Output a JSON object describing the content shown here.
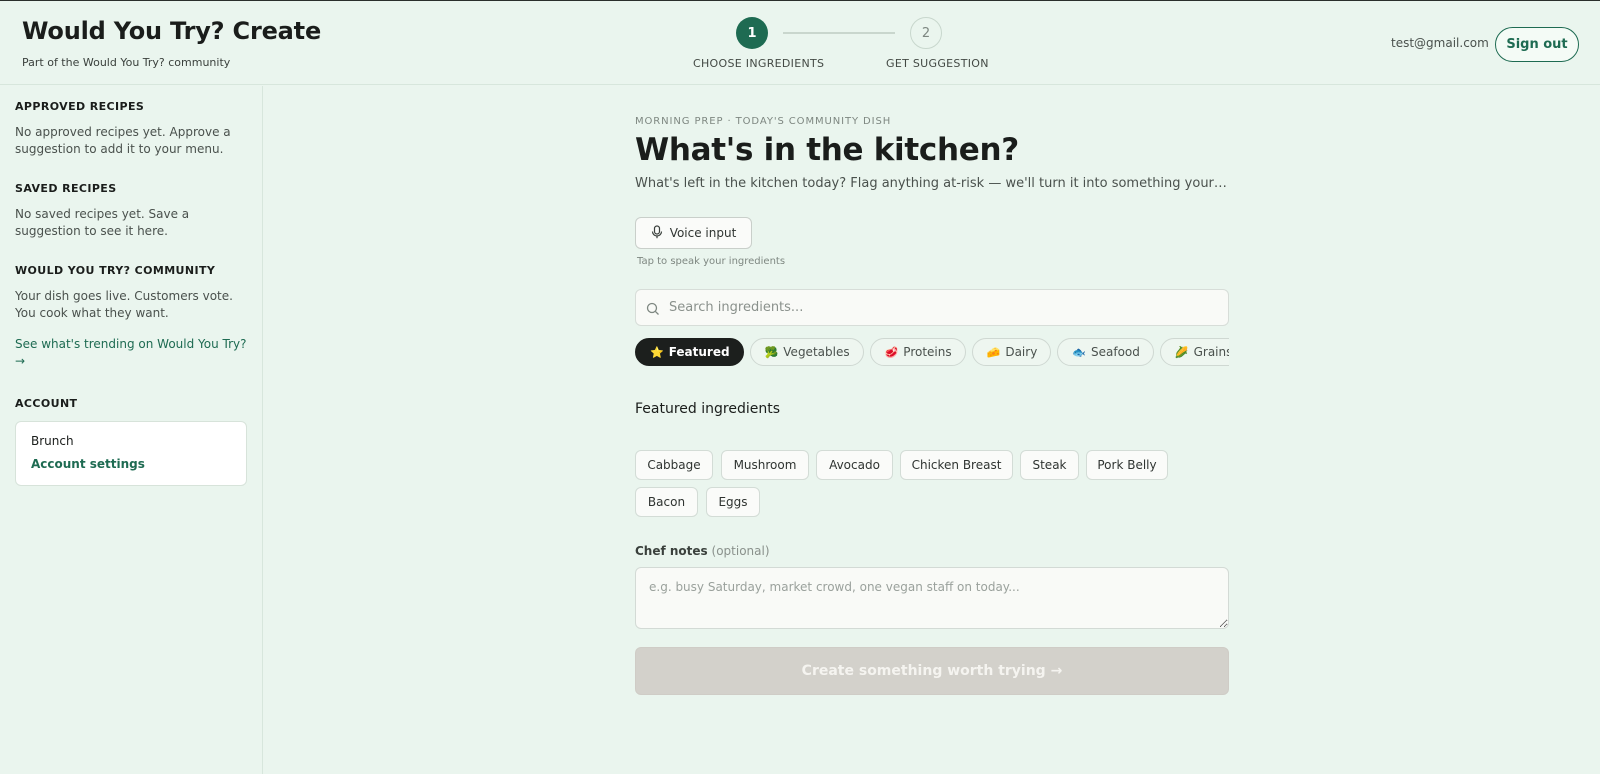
{
  "header": {
    "title": "Would You Try? Create",
    "subtitle": "Part of the Would You Try? community",
    "user_email": "test@gmail.com",
    "signout_label": "Sign out"
  },
  "stepper": {
    "steps": [
      {
        "number": "1",
        "label": "CHOOSE INGREDIENTS",
        "active": true
      },
      {
        "number": "2",
        "label": "GET SUGGESTION",
        "active": false
      }
    ]
  },
  "sidebar": {
    "approved": {
      "heading": "APPROVED RECIPES",
      "text": "No approved recipes yet. Approve a suggestion to add it to your menu."
    },
    "saved": {
      "heading": "SAVED RECIPES",
      "text": "No saved recipes yet. Save a suggestion to see it here."
    },
    "community": {
      "heading": "WOULD YOU TRY? COMMUNITY",
      "text": "Your dish goes live. Customers vote. You cook what they want.",
      "link": "See what's trending on Would You Try? →"
    },
    "account": {
      "heading": "ACCOUNT",
      "name": "Brunch",
      "settings_link": "Account settings"
    }
  },
  "main": {
    "eyebrow": "MORNING PREP · TODAY'S COMMUNITY DISH",
    "title": "What's in the kitchen?",
    "description": "What's left in the kitchen today? Flag anything at-risk — we'll turn it into something your community will love.",
    "voice_button": "Voice input",
    "voice_hint": "Tap to speak your ingredients",
    "search_placeholder": "Search ingredients...",
    "categories": [
      {
        "label": "Featured",
        "glyph": "⭐",
        "active": true
      },
      {
        "label": "Vegetables",
        "glyph": "🥦",
        "active": false
      },
      {
        "label": "Proteins",
        "glyph": "🥩",
        "active": false
      },
      {
        "label": "Dairy",
        "glyph": "🧀",
        "active": false
      },
      {
        "label": "Seafood",
        "glyph": "🐟",
        "active": false
      },
      {
        "label": "Grains & Br",
        "glyph": "🌽",
        "active": false
      }
    ],
    "section_title": "Featured ingredients",
    "ingredients": [
      "Cabbage",
      "Mushroom",
      "Avocado",
      "Chicken Breast",
      "Steak",
      "Pork Belly",
      "Bacon",
      "Eggs"
    ],
    "notes_label": "Chef notes",
    "notes_optional": "(optional)",
    "notes_placeholder": "e.g. busy Saturday, market crowd, one vegan staff on today...",
    "create_button": "Create something worth trying →"
  },
  "colors": {
    "background": "#eaf5ee",
    "accent": "#1e6b52",
    "active_chip": "#1c1f1d",
    "disabled_button": "#d3d1cb"
  }
}
